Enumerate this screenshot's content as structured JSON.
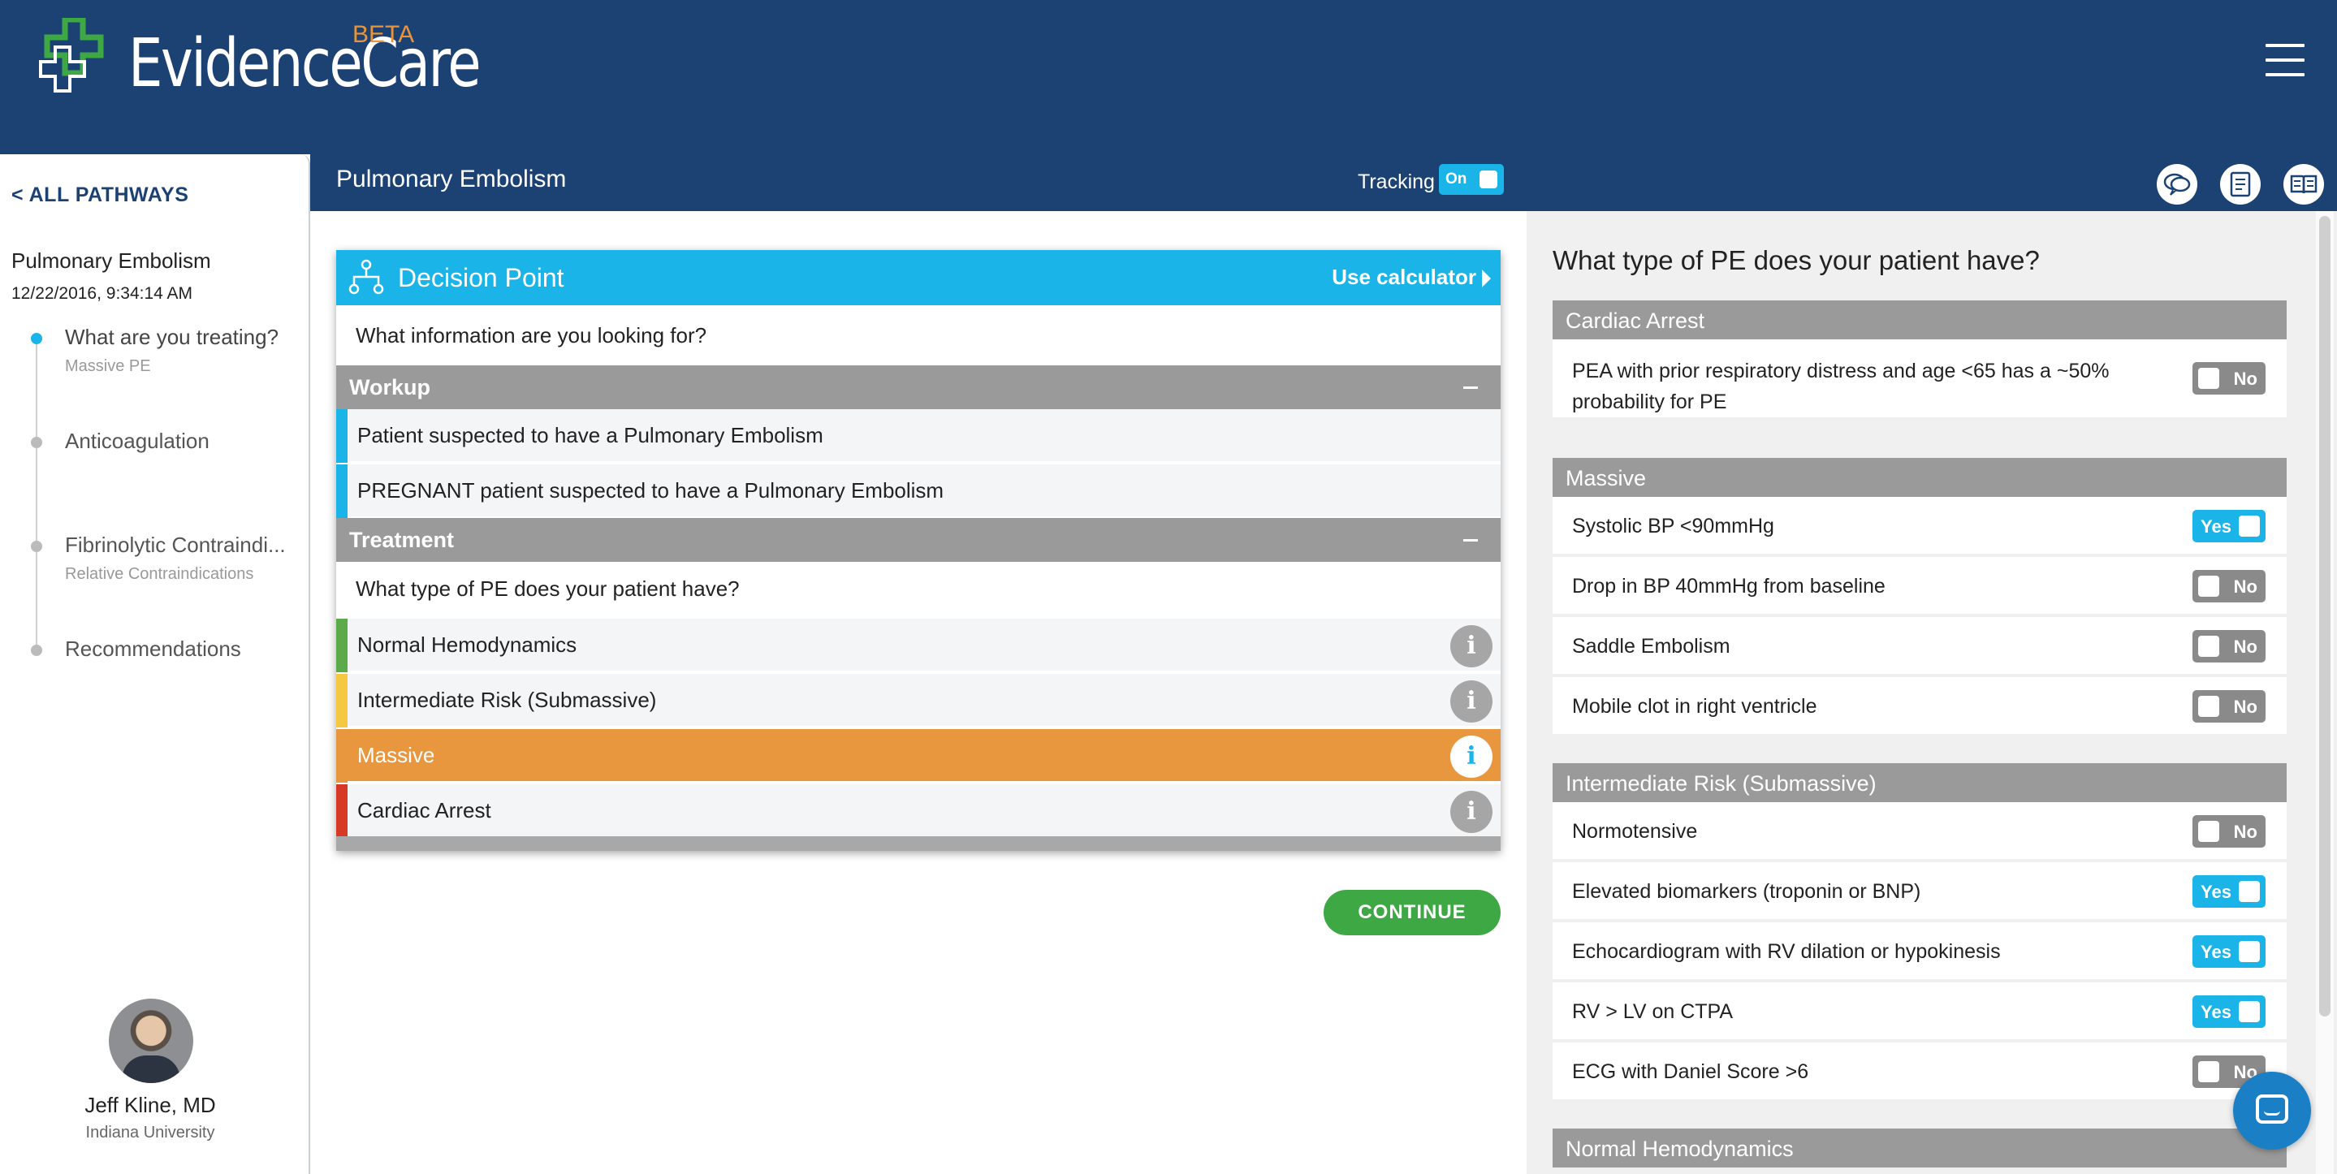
{
  "brand": {
    "name": "EvidenceCare",
    "beta": "BETA"
  },
  "titlebar": {
    "title": "Pulmonary Embolism",
    "tracking_label": "Tracking",
    "tracking_value": "On"
  },
  "sidebar": {
    "back_link": "< ALL PATHWAYS",
    "pathway_title": "Pulmonary Embolism",
    "timestamp": "12/22/2016, 9:34:14 AM",
    "steps": [
      {
        "label": "What are you treating?",
        "sub": "Massive PE"
      },
      {
        "label": "Anticoagulation",
        "sub": ""
      },
      {
        "label": "Fibrinolytic Contraindi...",
        "sub": "Relative Contraindications"
      },
      {
        "label": "Recommendations",
        "sub": ""
      }
    ],
    "author": {
      "name": "Jeff Kline, MD",
      "org": "Indiana University"
    }
  },
  "decision": {
    "title": "Decision Point",
    "calc_label": "Use calculator",
    "question": "What information are you looking for?",
    "workup": {
      "label": "Workup",
      "options": [
        "Patient suspected to have a Pulmonary Embolism",
        "PREGNANT patient suspected to have a Pulmonary Embolism"
      ]
    },
    "treatment": {
      "label": "Treatment",
      "question": "What type of PE does your patient have?",
      "options": [
        {
          "label": "Normal Hemodynamics",
          "color": "#5cab4a"
        },
        {
          "label": "Intermediate Risk (Submassive)",
          "color": "#f5c842"
        },
        {
          "label": "Massive",
          "color": "#e8973f",
          "selected": true
        },
        {
          "label": "Cardiac Arrest",
          "color": "#d63a27"
        }
      ]
    },
    "continue_label": "CONTINUE"
  },
  "panel": {
    "question": "What type of PE does your patient have?",
    "sections": [
      {
        "label": "Cardiac Arrest",
        "rows": [
          {
            "label": "PEA with prior respiratory distress and age <65 has a ~50% probability for PE",
            "value": "No"
          }
        ]
      },
      {
        "label": "Massive",
        "rows": [
          {
            "label": "Systolic BP <90mmHg",
            "value": "Yes"
          },
          {
            "label": "Drop in BP 40mmHg from baseline",
            "value": "No"
          },
          {
            "label": "Saddle Embolism",
            "value": "No"
          },
          {
            "label": "Mobile clot in right ventricle",
            "value": "No"
          }
        ]
      },
      {
        "label": "Intermediate Risk (Submassive)",
        "rows": [
          {
            "label": "Normotensive",
            "value": "No"
          },
          {
            "label": "Elevated biomarkers (troponin or BNP)",
            "value": "Yes"
          },
          {
            "label": "Echocardiogram with RV dilation or hypokinesis",
            "value": "Yes"
          },
          {
            "label": "RV > LV on CTPA",
            "value": "Yes"
          },
          {
            "label": "ECG with Daniel Score >6",
            "value": "No"
          }
        ]
      },
      {
        "label": "Normal Hemodynamics",
        "rows": []
      }
    ]
  },
  "colors": {
    "navy": "#1c4274",
    "accent_blue": "#1ab4e8",
    "green": "#3ea844",
    "orange": "#e8973f"
  },
  "icons": [
    "hamburger-menu-icon",
    "feedback-icon",
    "document-icon",
    "book-icon",
    "decision-tree-icon",
    "info-icon",
    "chat-icon"
  ]
}
